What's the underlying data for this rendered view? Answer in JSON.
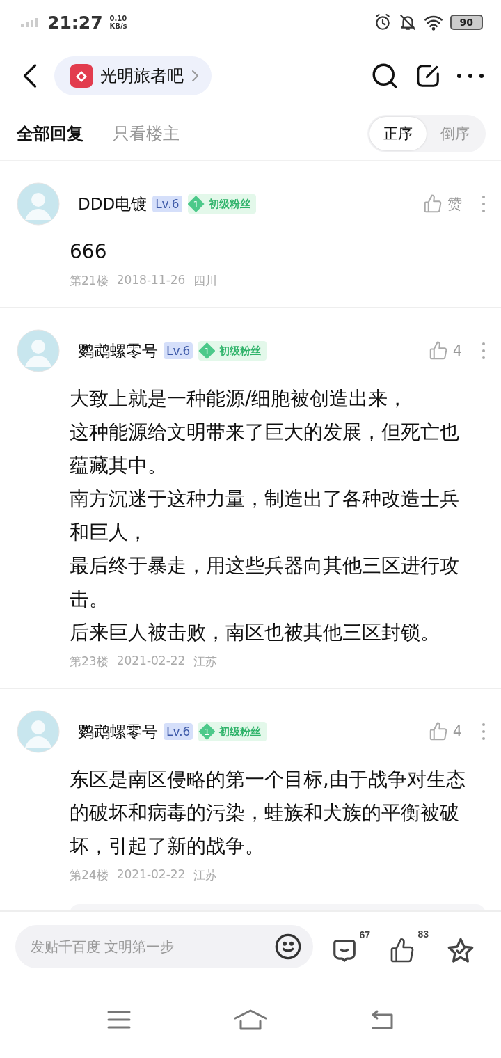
{
  "status_bar": {
    "time": "21:27",
    "speed_value": "0.10",
    "speed_unit": "KB/s",
    "battery": "90"
  },
  "nav": {
    "forum": "光明旅者吧"
  },
  "tabs": [
    {
      "label": "全部回复",
      "selected": true
    },
    {
      "label": "只看楼主",
      "selected": false
    }
  ],
  "sort": [
    {
      "label": "正序",
      "selected": true
    },
    {
      "label": "倒序",
      "selected": false
    }
  ],
  "posts": [
    {
      "author": "DDD电镀",
      "level": "Lv.6",
      "fan_rank": "1",
      "fan_title": "初级粉丝",
      "like": "赞",
      "paragraphs": [
        "666"
      ],
      "floor": "第21楼",
      "date": "2018-11-26",
      "location": "四川",
      "has_reply_preview": false
    },
    {
      "author": "鹦鹉螺零号",
      "level": "Lv.6",
      "fan_rank": "1",
      "fan_title": "初级粉丝",
      "like": "4",
      "paragraphs": [
        "大致上就是一种能源/细胞被创造出来，",
        "这种能源给文明带来了巨大的发展，但死亡也蕴藏其中。",
        "南方沉迷于这种力量，制造出了各种改造士兵和巨人，",
        "最后终于暴走，用这些兵器向其他三区进行攻击。",
        "后来巨人被击败，南区也被其他三区封锁。"
      ],
      "floor": "第23楼",
      "date": "2021-02-22",
      "location": "江苏",
      "has_reply_preview": false
    },
    {
      "author": "鹦鹉螺零号",
      "level": "Lv.6",
      "fan_rank": "1",
      "fan_title": "初级粉丝",
      "like": "4",
      "paragraphs": [
        "东区是南区侵略的第一个目标,由于战争对生态的破坏和病毒的污染，蛙族和犬族的平衡被破坏，引起了新的战争。"
      ],
      "floor": "第24楼",
      "date": "2021-02-22",
      "location": "江苏",
      "has_reply_preview": true
    }
  ],
  "composer": {
    "placeholder": "发贴千百度 文明第一步",
    "comments": "67",
    "likes": "83"
  }
}
